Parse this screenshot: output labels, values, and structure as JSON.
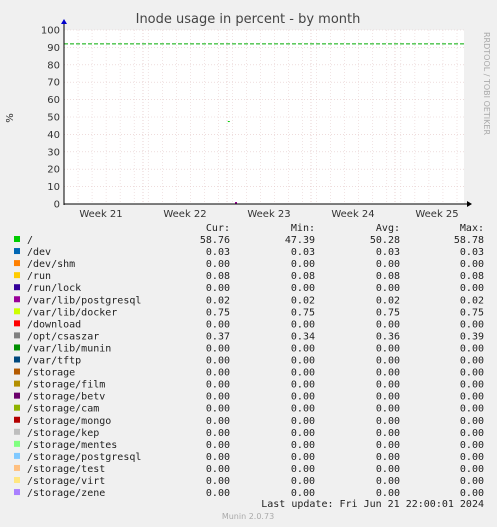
{
  "chart_data": {
    "type": "line",
    "title": "Inode usage in percent - by month",
    "ylabel": "%",
    "side_label": "RRDTOOL / TOBI OETIKER",
    "ylim": [
      0,
      100
    ],
    "yticks": [
      0,
      10,
      20,
      30,
      40,
      50,
      60,
      70,
      80,
      90,
      100
    ],
    "x_ticks": [
      "Week 21",
      "Week 22",
      "Week 23",
      "Week 24",
      "Week 25"
    ],
    "warning_level": 92,
    "warning_color": "#00aa00",
    "series_visible": {
      "name": "/",
      "color": "#00cc00",
      "points": [
        {
          "x": 0.412,
          "y": 47.39
        }
      ]
    },
    "legend_headers": [
      "Cur:",
      "Min:",
      "Avg:",
      "Max:"
    ],
    "legend": [
      {
        "name": "/",
        "color": "#00cc00",
        "cur": "58.76",
        "min": "47.39",
        "avg": "50.28",
        "max": "58.78"
      },
      {
        "name": "/dev",
        "color": "#0066b3",
        "cur": "0.03",
        "min": "0.03",
        "avg": "0.03",
        "max": "0.03"
      },
      {
        "name": "/dev/shm",
        "color": "#ff8000",
        "cur": "0.00",
        "min": "0.00",
        "avg": "0.00",
        "max": "0.00"
      },
      {
        "name": "/run",
        "color": "#ffcc00",
        "cur": "0.08",
        "min": "0.08",
        "avg": "0.08",
        "max": "0.08"
      },
      {
        "name": "/run/lock",
        "color": "#330099",
        "cur": "0.00",
        "min": "0.00",
        "avg": "0.00",
        "max": "0.00"
      },
      {
        "name": "/var/lib/postgresql",
        "color": "#990099",
        "cur": "0.02",
        "min": "0.02",
        "avg": "0.02",
        "max": "0.02"
      },
      {
        "name": "/var/lib/docker",
        "color": "#ccff00",
        "cur": "0.75",
        "min": "0.75",
        "avg": "0.75",
        "max": "0.75"
      },
      {
        "name": "/download",
        "color": "#ff0000",
        "cur": "0.00",
        "min": "0.00",
        "avg": "0.00",
        "max": "0.00"
      },
      {
        "name": "/opt/csaszar",
        "color": "#808080",
        "cur": "0.37",
        "min": "0.34",
        "avg": "0.36",
        "max": "0.39"
      },
      {
        "name": "/var/lib/munin",
        "color": "#008f00",
        "cur": "0.00",
        "min": "0.00",
        "avg": "0.00",
        "max": "0.00"
      },
      {
        "name": "/var/tftp",
        "color": "#00487d",
        "cur": "0.00",
        "min": "0.00",
        "avg": "0.00",
        "max": "0.00"
      },
      {
        "name": "/storage",
        "color": "#b35a00",
        "cur": "0.00",
        "min": "0.00",
        "avg": "0.00",
        "max": "0.00"
      },
      {
        "name": "/storage/film",
        "color": "#b38f00",
        "cur": "0.00",
        "min": "0.00",
        "avg": "0.00",
        "max": "0.00"
      },
      {
        "name": "/storage/betv",
        "color": "#6b006b",
        "cur": "0.00",
        "min": "0.00",
        "avg": "0.00",
        "max": "0.00"
      },
      {
        "name": "/storage/cam",
        "color": "#8fb300",
        "cur": "0.00",
        "min": "0.00",
        "avg": "0.00",
        "max": "0.00"
      },
      {
        "name": "/storage/mongo",
        "color": "#b30000",
        "cur": "0.00",
        "min": "0.00",
        "avg": "0.00",
        "max": "0.00"
      },
      {
        "name": "/storage/kep",
        "color": "#bebebe",
        "cur": "0.00",
        "min": "0.00",
        "avg": "0.00",
        "max": "0.00"
      },
      {
        "name": "/storage/mentes",
        "color": "#80ff80",
        "cur": "0.00",
        "min": "0.00",
        "avg": "0.00",
        "max": "0.00"
      },
      {
        "name": "/storage/postgresql",
        "color": "#80c9ff",
        "cur": "0.00",
        "min": "0.00",
        "avg": "0.00",
        "max": "0.00"
      },
      {
        "name": "/storage/test",
        "color": "#ffc080",
        "cur": "0.00",
        "min": "0.00",
        "avg": "0.00",
        "max": "0.00"
      },
      {
        "name": "/storage/virt",
        "color": "#ffe680",
        "cur": "0.00",
        "min": "0.00",
        "avg": "0.00",
        "max": "0.00"
      },
      {
        "name": "/storage/zene",
        "color": "#aa80ff",
        "cur": "0.00",
        "min": "0.00",
        "avg": "0.00",
        "max": "0.00"
      }
    ],
    "last_update": "Last update: Fri Jun 21 22:00:01 2024",
    "footer": "Munin 2.0.73"
  }
}
